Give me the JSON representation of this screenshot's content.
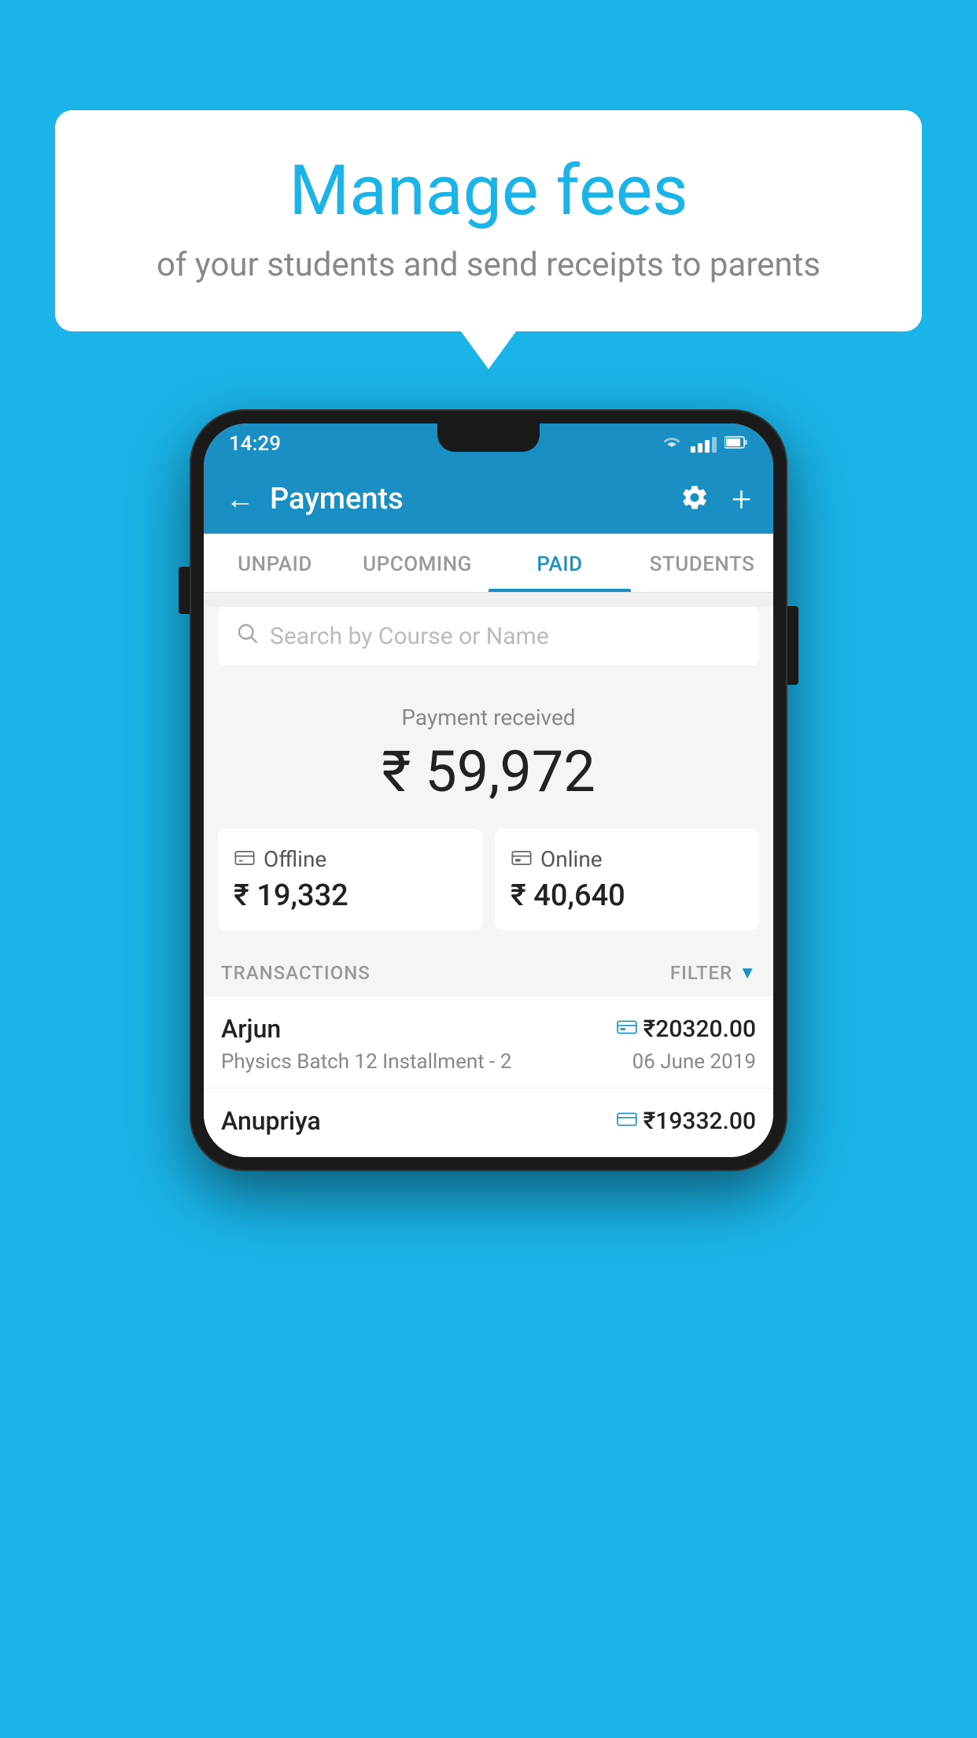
{
  "background": {
    "color": "#1ab4e8"
  },
  "speech_bubble": {
    "title": "Manage fees",
    "subtitle": "of your students and send receipts to parents"
  },
  "phone": {
    "status_bar": {
      "time": "14:29"
    },
    "app_bar": {
      "title": "Payments",
      "back_label": "←",
      "plus_label": "+"
    },
    "tabs": [
      {
        "label": "UNPAID",
        "active": false
      },
      {
        "label": "UPCOMING",
        "active": false
      },
      {
        "label": "PAID",
        "active": true
      },
      {
        "label": "STUDENTS",
        "active": false
      }
    ],
    "search": {
      "placeholder": "Search by Course or Name"
    },
    "payment_received": {
      "label": "Payment received",
      "amount": "₹ 59,972"
    },
    "payment_cards": [
      {
        "type": "Offline",
        "amount": "₹ 19,332",
        "icon": "💳"
      },
      {
        "type": "Online",
        "amount": "₹ 40,640",
        "icon": "💳"
      }
    ],
    "transactions_section": {
      "label": "TRANSACTIONS",
      "filter_label": "FILTER"
    },
    "transactions": [
      {
        "name": "Arjun",
        "amount": "₹20320.00",
        "course": "Physics Batch 12 Installment - 2",
        "date": "06 June 2019",
        "type": "online"
      },
      {
        "name": "Anupriya",
        "amount": "₹19332.00",
        "course": "",
        "date": "",
        "type": "offline"
      }
    ]
  }
}
